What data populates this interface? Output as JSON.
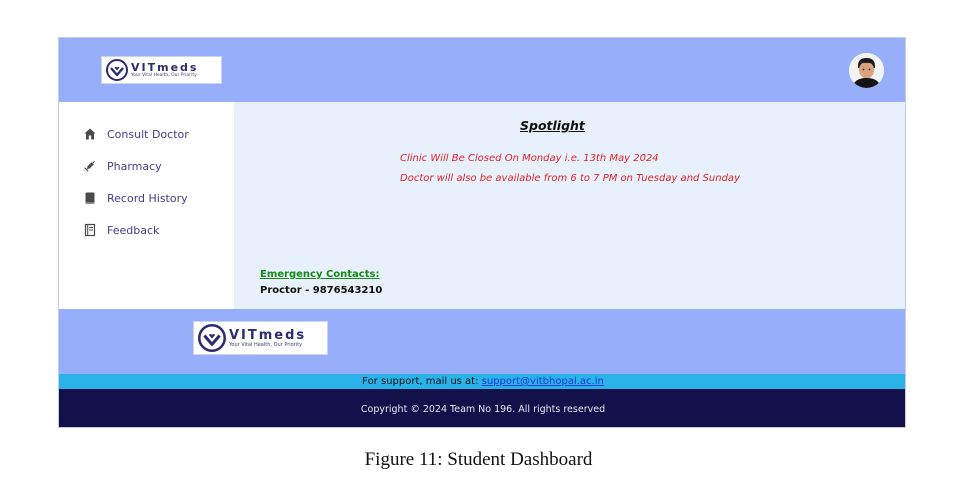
{
  "header": {
    "logo": {
      "name": "VITmeds",
      "tagline": "Your Vital Health, Our Priority"
    }
  },
  "sidebar": {
    "items": [
      {
        "label": "Consult Doctor",
        "icon": "home-icon"
      },
      {
        "label": "Pharmacy",
        "icon": "syringe-icon"
      },
      {
        "label": "Record History",
        "icon": "book-icon"
      },
      {
        "label": "Feedback",
        "icon": "feedback-icon"
      }
    ]
  },
  "main": {
    "spotlight_title": "Spotlight",
    "notices": [
      "Clinic Will Be Closed On Monday i.e. 13th May 2024",
      "Doctor will also be available from 6 to 7 PM on Tuesday and Sunday"
    ],
    "emergency_title": "Emergency Contacts:",
    "proctor": "Proctor - 9876543210"
  },
  "footer": {
    "logo": {
      "name": "VITmeds",
      "tagline": "Your Vital Health, Our Priority"
    },
    "support_text": "For support, mail us at: ",
    "support_email": "support@vitbhopal.ac.in",
    "copyright": "Copyright © 2024 Team No 196.  All rights reserved"
  },
  "caption": "Figure 11: Student Dashboard",
  "colors": {
    "header_bg": "#97aefa",
    "main_bg": "#e8f1fb",
    "notice_red": "#e2222a",
    "emergency_green": "#138a13",
    "support_bar": "#2ab3e8",
    "copyright_bar": "#13114a",
    "nav_text": "#4b3a8a"
  }
}
